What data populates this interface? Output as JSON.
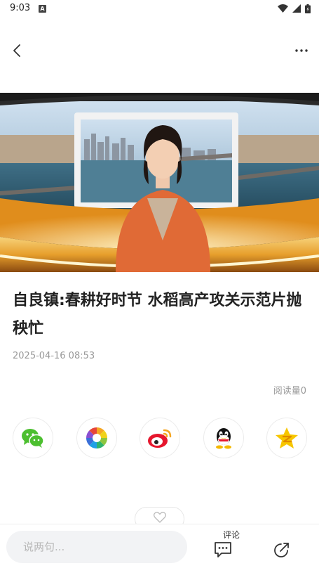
{
  "status_bar": {
    "time": "9:03",
    "notification_badge": "A"
  },
  "nav": {
    "back_icon": "chevron-left-icon",
    "more_icon": "more-horizontal-icon"
  },
  "video": {
    "description_icon": "video-thumbnail"
  },
  "article": {
    "title": "自良镇:春耕好时节 水稻高产攻关示范片抛秧忙",
    "date": "2025-04-16 08:53",
    "read_count": "阅读量0"
  },
  "share": {
    "items": [
      {
        "icon": "wechat-icon",
        "color": "#4cbf2f"
      },
      {
        "icon": "moments-icon",
        "color": "#f5a623"
      },
      {
        "icon": "weibo-icon",
        "color": "#e6162d"
      },
      {
        "icon": "qq-icon",
        "color": "#111111"
      },
      {
        "icon": "qzone-icon",
        "color": "#f7c600"
      }
    ]
  },
  "like": {
    "icon": "heart-icon"
  },
  "bottom_bar": {
    "comment_placeholder": "说两句...",
    "comment_label": "评论",
    "comment_icon": "comment-icon",
    "share_icon": "share-icon"
  }
}
